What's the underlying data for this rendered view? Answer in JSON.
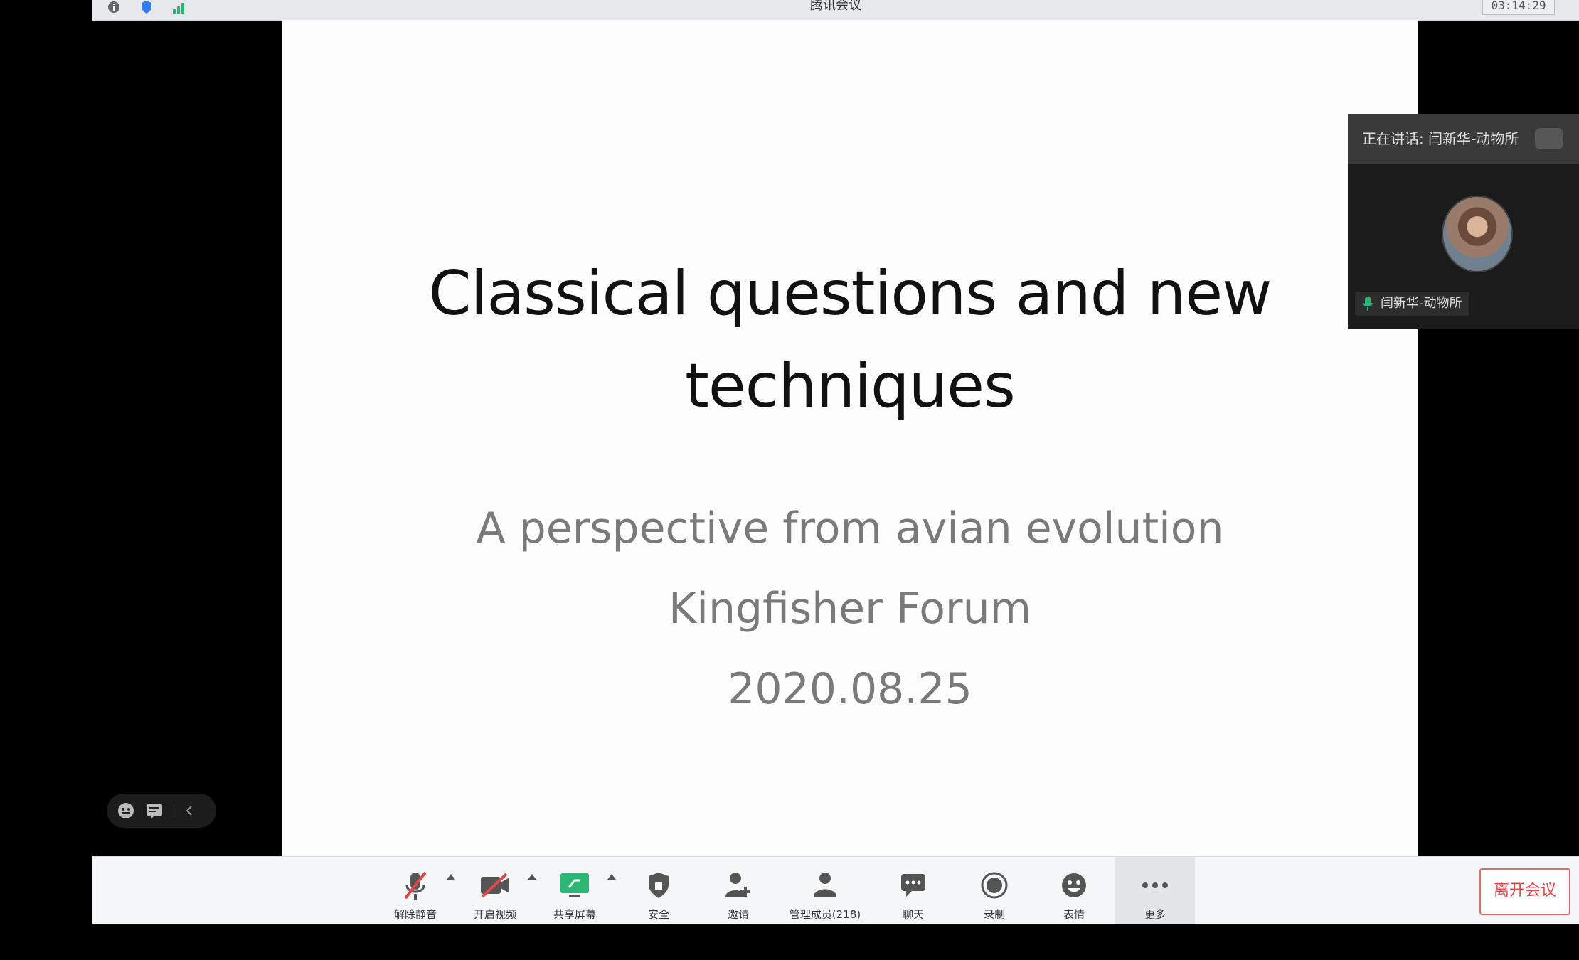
{
  "window": {
    "title": "腾讯会议",
    "time": "03:14:29"
  },
  "slide": {
    "title_line1": "Classical questions and new",
    "title_line2": "techniques",
    "subtitle": "A perspective from avian evolution",
    "event": "Kingfisher Forum",
    "date": "2020.08.25"
  },
  "speaker_panel": {
    "header": "正在讲话: 闫新华-动物所",
    "name": "闫新华-动物所"
  },
  "toolbar": {
    "items": [
      {
        "label": "解除静音",
        "icon": "muted-mic-icon"
      },
      {
        "label": "开启视频",
        "icon": "video-off-icon"
      },
      {
        "label": "共享屏幕",
        "icon": "share-screen-icon"
      },
      {
        "label": "安全",
        "icon": "security-icon"
      },
      {
        "label": "邀请",
        "icon": "invite-icon"
      },
      {
        "label": "管理成员(218)",
        "icon": "members-icon"
      },
      {
        "label": "聊天",
        "icon": "chat-icon"
      },
      {
        "label": "录制",
        "icon": "record-icon"
      },
      {
        "label": "表情",
        "icon": "emoji-icon"
      },
      {
        "label": "更多",
        "icon": "more-icon"
      }
    ],
    "leave_label": "离开会议"
  },
  "colors": {
    "accent_green": "#2bb673",
    "leave_red": "#e04848"
  }
}
